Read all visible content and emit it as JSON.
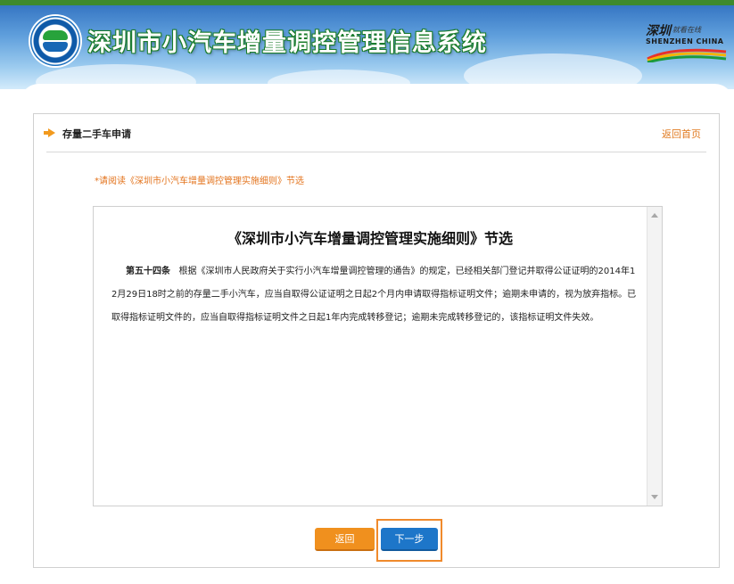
{
  "header": {
    "site_title": "深圳市小汽车增量调控管理信息系统",
    "city_logo_cn": "深圳",
    "city_logo_tagline": "就看在线",
    "city_logo_en": "SHENZHEN  CHINA"
  },
  "panel": {
    "title": "存量二手车申请",
    "home_link": "返回首页",
    "notice": "*请阅读《深圳市小汽车增量调控管理实施细则》节选"
  },
  "document": {
    "title": "《深圳市小汽车增量调控管理实施细则》节选",
    "article_label": "第五十四条",
    "article_body": "根据《深圳市人民政府关于实行小汽车增量调控管理的通告》的规定，已经相关部门登记并取得公证证明的2014年12月29日18时之前的存量二手小汽车，应当自取得公证证明之日起2个月内申请取得指标证明文件；逾期未申请的，视为放弃指标。已取得指标证明文件的，应当自取得指标证明文件之日起1年内完成转移登记；逾期未完成转移登记的，该指标证明文件失效。"
  },
  "actions": {
    "back_label": "返回",
    "next_label": "下一步"
  },
  "colors": {
    "accent_orange": "#f0901e",
    "accent_blue": "#1d76c9",
    "header_green": "#3e8a2e"
  }
}
